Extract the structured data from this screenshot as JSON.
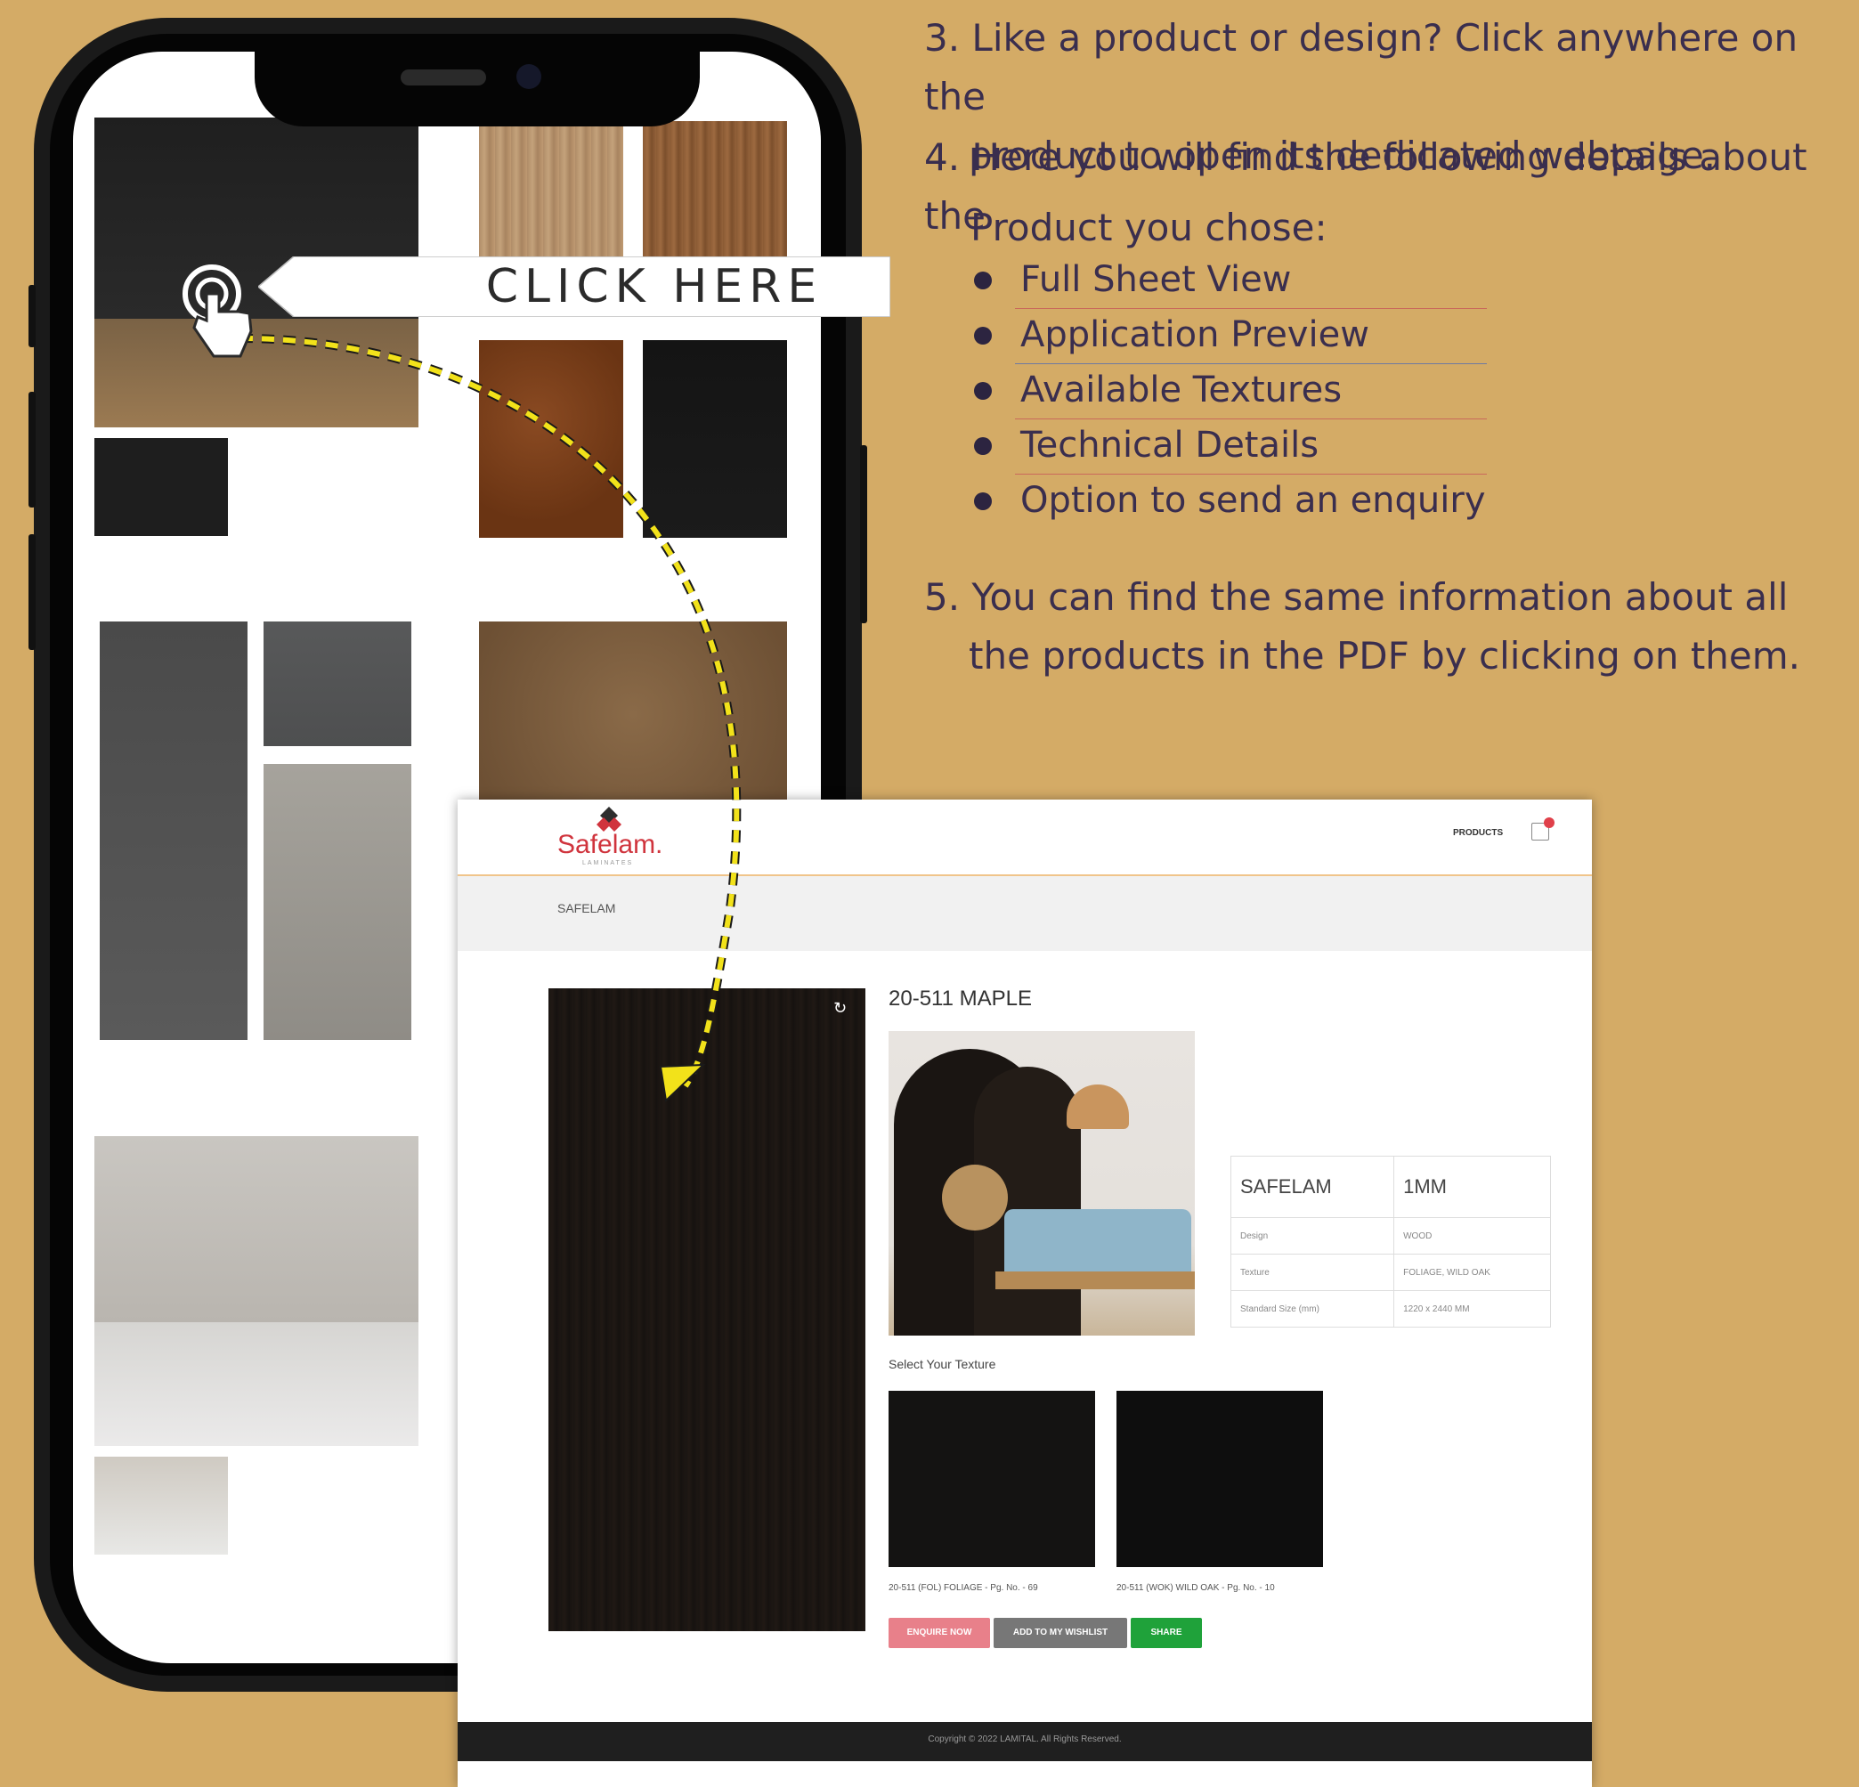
{
  "instructions": {
    "step3_line1": "3. Like a product or design? Click anywhere on the",
    "step3_line2": "product to open its dedicated webpage.",
    "step4_line1": "4. Here you will find the following details about the",
    "step4_line2": "Product you chose:",
    "details": [
      "Full Sheet View",
      "Application Preview",
      "Available Textures",
      "Technical Details",
      "Option to send an enquiry"
    ],
    "step5_line1": "5. You can find the same information about all",
    "step5_line2": "the products in the PDF by clicking on them."
  },
  "callout": {
    "label": "CLICK HERE"
  },
  "colors": {
    "background": "#d4ab66",
    "text": "#3a2e4e",
    "arrow": "#f2e21a",
    "brand": "#d0343d"
  },
  "webpage": {
    "logo": "Safelam.",
    "logo_sub": "LAMINATES",
    "nav_products": "PRODUCTS",
    "breadcrumb": "SAFELAM",
    "product_title": "20-511 MAPLE",
    "spec": {
      "brand": "SAFELAM",
      "thickness": "1MM",
      "rows": [
        {
          "label": "Design",
          "value": "WOOD"
        },
        {
          "label": "Texture",
          "value": "FOLIAGE, WILD OAK"
        },
        {
          "label": "Standard Size (mm)",
          "value": "1220 x 2440 MM"
        }
      ]
    },
    "select_texture_label": "Select Your Texture",
    "textures": [
      {
        "caption": "20-511 (FOL) FOLIAGE - Pg. No. - 69"
      },
      {
        "caption": "20-511 (WOK) WILD OAK - Pg. No. - 10"
      }
    ],
    "buttons": {
      "enquire": "ENQUIRE NOW",
      "wishlist": "ADD TO MY WISHLIST",
      "share": "SHARE"
    },
    "footer": "Copyright © 2022 LAMITAL. All Rights Reserved."
  }
}
